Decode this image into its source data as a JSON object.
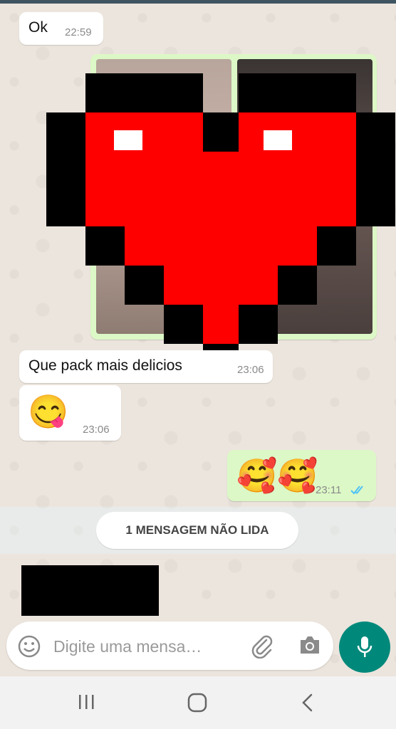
{
  "messages": [
    {
      "text": "Ok",
      "time": "22:59",
      "direction": "incoming"
    },
    {
      "type": "image",
      "direction": "outgoing",
      "censored_with": "pixel-heart-icon"
    },
    {
      "text": "Que pack mais delicios",
      "time": "23:06",
      "direction": "incoming"
    },
    {
      "emoji": "😋",
      "time": "23:06",
      "direction": "incoming"
    },
    {
      "emoji": "🥰🥰",
      "time": "23:11",
      "direction": "outgoing",
      "status": "read"
    }
  ],
  "unread_banner": "1 MENSAGEM NÃO LIDA",
  "composer": {
    "placeholder": "Digite uma mensa…"
  },
  "colors": {
    "outgoing_bubble": "#DCF8C6",
    "incoming_bubble": "#FFFFFF",
    "mic_button": "#00897B",
    "read_ticks": "#4FC3F7",
    "heart_red": "#FF0000"
  },
  "icons": {
    "emoji": "emoji-icon",
    "attach": "paperclip-icon",
    "camera": "camera-icon",
    "mic": "mic-icon",
    "nav_recents": "recents-icon",
    "nav_home": "home-icon",
    "nav_back": "back-icon"
  }
}
